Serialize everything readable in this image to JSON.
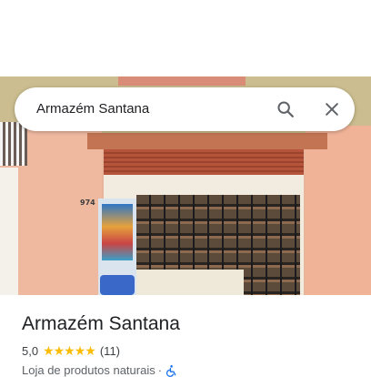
{
  "search": {
    "query": "Armazém Santana"
  },
  "photo": {
    "storefront_number": "974"
  },
  "place": {
    "name": "Armazém Santana",
    "rating": "5,0",
    "stars": "★★★★★",
    "review_count": "(11)",
    "category": "Loja de produtos naturais",
    "separator": "·"
  },
  "icons": {
    "search": "search-icon",
    "close": "close-icon",
    "accessibility": "wheelchair-icon"
  },
  "colors": {
    "star": "#fbbc04",
    "accessibility_icon": "#1a73e8"
  }
}
